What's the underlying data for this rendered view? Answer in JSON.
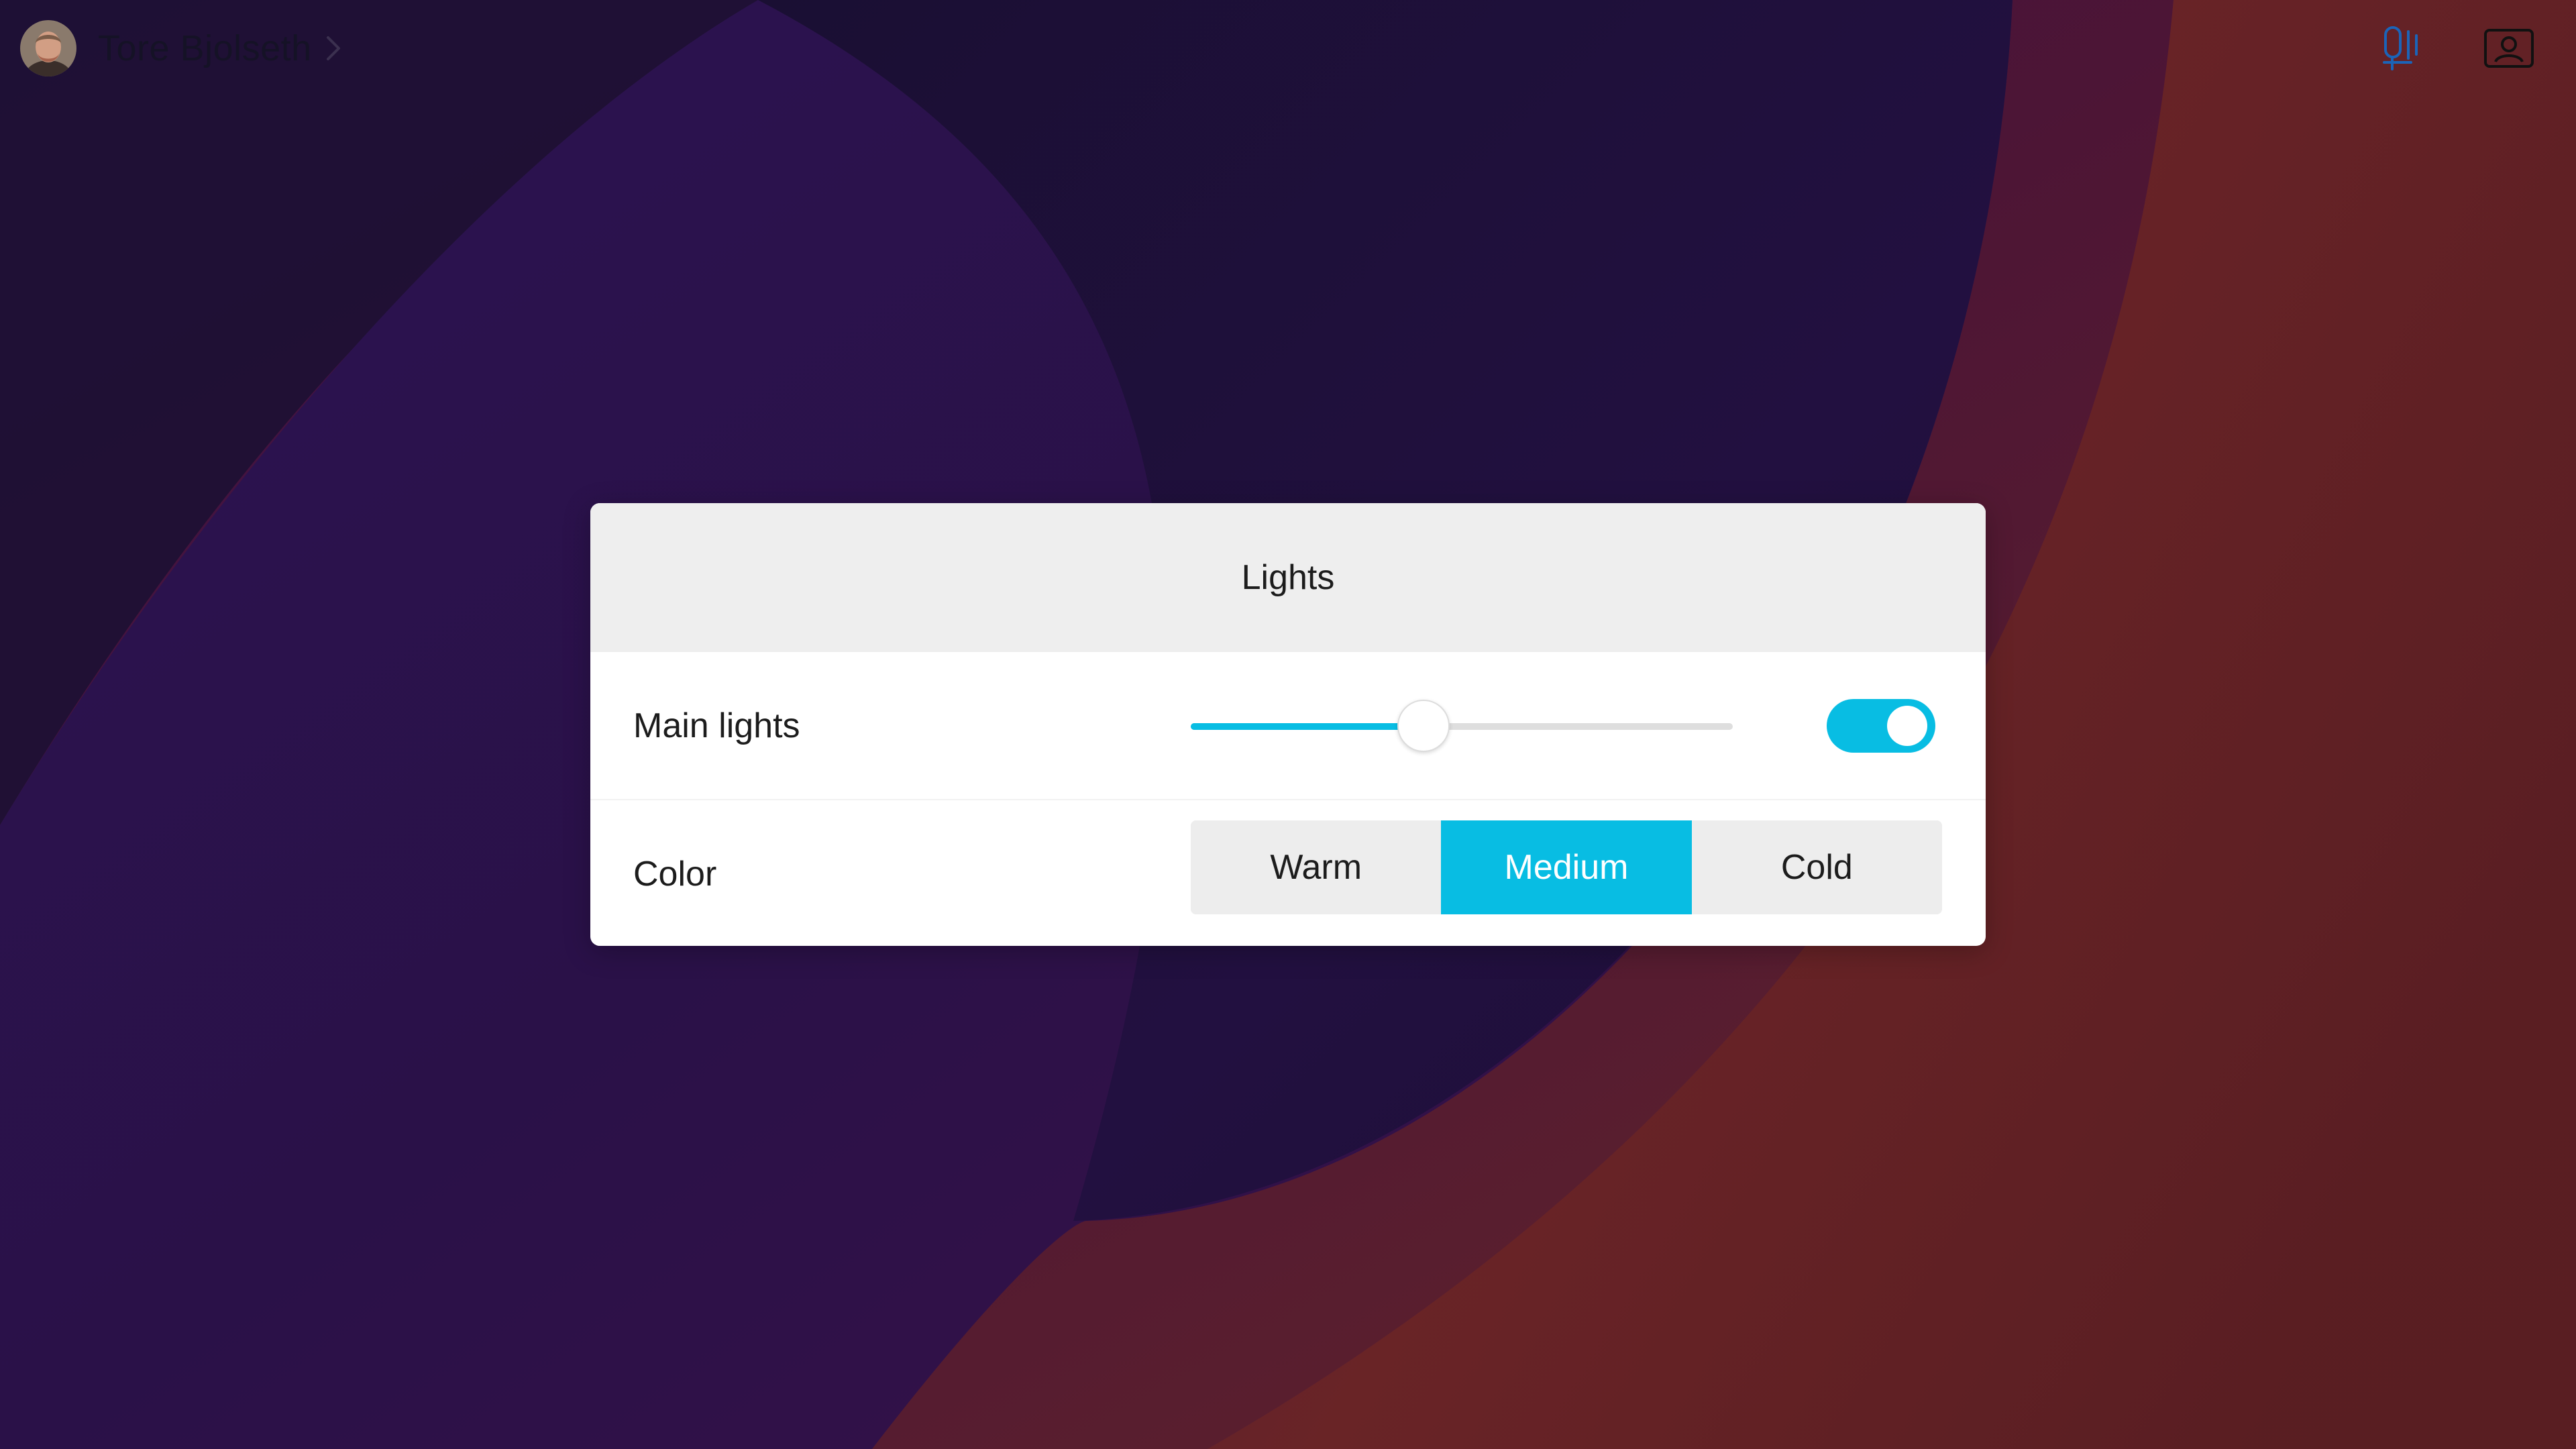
{
  "user": {
    "name": "Tore Bjolseth"
  },
  "top_controls": {
    "mic_icon": "microphone-icon",
    "selfview_icon": "selfview-icon"
  },
  "lights_panel": {
    "title": "Lights",
    "main_lights": {
      "label": "Main lights",
      "level": 0.43,
      "on": true
    },
    "color": {
      "label": "Color",
      "options": [
        "Warm",
        "Medium",
        "Cold"
      ],
      "selected": "Medium"
    }
  },
  "colors": {
    "accent": "#08bde3",
    "panel_header": "#eeeeee",
    "background_dark": "#1f0f3a",
    "background_warm": "#6b2524"
  }
}
